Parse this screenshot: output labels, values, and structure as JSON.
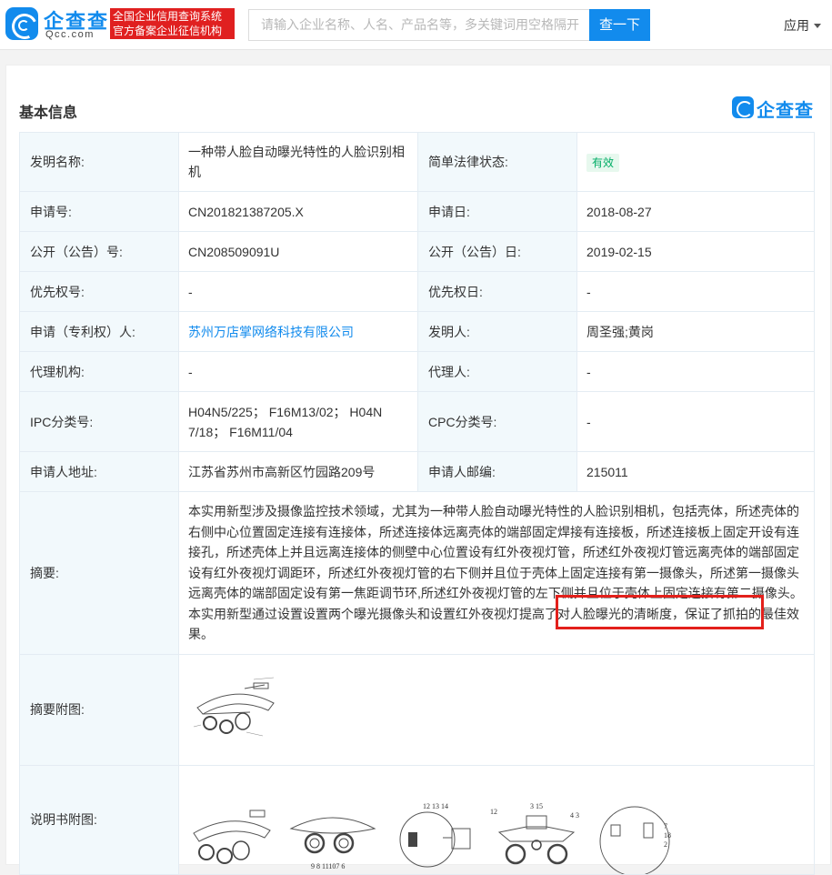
{
  "header": {
    "logo_cn": "企查查",
    "logo_en": "Qcc.com",
    "slogan_line1": "全国企业信用查询系统",
    "slogan_line2": "官方备案企业征信机构",
    "search_placeholder": "请输入企业名称、人名、产品名等，多关键词用空格隔开",
    "search_button": "查一下",
    "apps_label": "应用"
  },
  "section": {
    "title": "基本信息",
    "brand": "企查查"
  },
  "colors": {
    "brand": "#128bed",
    "slogan_bg": "#e02020",
    "label_bg": "#f2f9fc",
    "status_green": "#00ad65",
    "highlight": "#e3201b"
  },
  "rows": {
    "invention_name_label": "发明名称:",
    "invention_name_line1": "一种带人脸自动曝光特性的人脸识别相",
    "invention_name_line2": "机",
    "legal_status_label": "简单法律状态:",
    "legal_status_value": "有效",
    "app_no_label": "申请号:",
    "app_no_value": "CN201821387205.X",
    "app_date_label": "申请日:",
    "app_date_value": "2018-08-27",
    "pub_no_label": "公开（公告）号:",
    "pub_no_value": "CN208509091U",
    "pub_date_label": "公开（公告）日:",
    "pub_date_value": "2019-02-15",
    "priority_no_label": "优先权号:",
    "priority_no_value": "-",
    "priority_date_label": "优先权日:",
    "priority_date_value": "-",
    "applicant_label": "申请（专利权）人:",
    "applicant_value": "苏州万店掌网络科技有限公司",
    "inventor_label": "发明人:",
    "inventor_value": "周圣强;黄岗",
    "agency_label": "代理机构:",
    "agency_value": "-",
    "agent_label": "代理人:",
    "agent_value": "-",
    "ipc_label": "IPC分类号:",
    "ipc_line1": "H04N5/225；  F16M13/02；  H04N",
    "ipc_line2": "7/18；  F16M11/04",
    "cpc_label": "CPC分类号:",
    "cpc_value": "-",
    "address_label": "申请人地址:",
    "address_value": "江苏省苏州市高新区竹园路209号",
    "postcode_label": "申请人邮编:",
    "postcode_value": "215011",
    "abstract_label": "摘要:",
    "abstract_lines": [
      "本实用新型涉及摄像监控技术领域，尤其为一种带人脸自动曝光特性的人脸识别相机，包括壳体，所述壳体的",
      "右侧中心位置固定连接有连接体，所述连接体远离壳体的端部固定焊接有连接板，所述连接板上固定开设有连",
      "接孔，所述壳体上并且远离连接体的侧壁中心位置设有红外夜视灯管，所述红外夜视灯管远离壳体的端部固定",
      "设有红外夜视灯调距环，所述红外夜视灯管的右下侧并且位于壳体上固定连接有第一摄像头，所述第一摄像头",
      "远离壳体的端部固定设有第一焦距调节环,所述红外夜视灯管的左下侧并且位于壳体上固定连接有第二摄像头。",
      "本实用新型通过设置设置两个曝光摄像头和设置红外夜视灯提高了对人脸曝光的清晰度，保证了抓拍的最佳效",
      "果。"
    ],
    "abstract_fig_label": "摘要附图:",
    "spec_fig_label": "说明书附图:"
  }
}
